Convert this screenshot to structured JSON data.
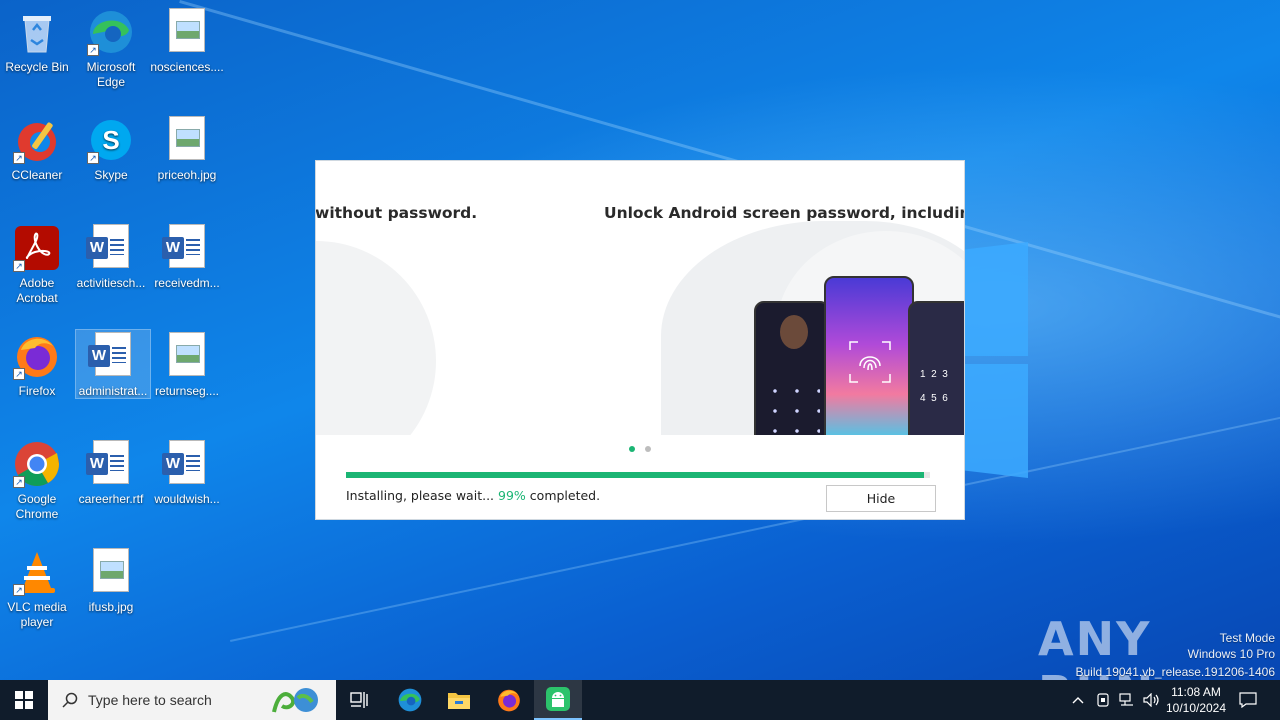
{
  "desktop": {
    "icons": [
      {
        "label": "Recycle Bin",
        "kind": "recycle-bin"
      },
      {
        "label": "Microsoft Edge",
        "kind": "edge"
      },
      {
        "label": "nosciences....",
        "kind": "image-file"
      },
      {
        "label": "CCleaner",
        "kind": "ccleaner"
      },
      {
        "label": "Skype",
        "kind": "skype"
      },
      {
        "label": "priceoh.jpg",
        "kind": "image-file"
      },
      {
        "label": "Adobe Acrobat",
        "kind": "acrobat"
      },
      {
        "label": "activitiesch...",
        "kind": "word-file"
      },
      {
        "label": "receivedm...",
        "kind": "word-file"
      },
      {
        "label": "Firefox",
        "kind": "firefox"
      },
      {
        "label": "administrat...",
        "kind": "word-file"
      },
      {
        "label": "returnseg....",
        "kind": "image-file"
      },
      {
        "label": "Google Chrome",
        "kind": "chrome"
      },
      {
        "label": "careerher.rtf",
        "kind": "word-file"
      },
      {
        "label": "wouldwish...",
        "kind": "word-file"
      },
      {
        "label": "VLC media player",
        "kind": "vlc"
      },
      {
        "label": "ifusb.jpg",
        "kind": "image-file"
      }
    ]
  },
  "installer": {
    "slide_text_left": "without password.",
    "slide_text_right": "Unlock Android screen password, including PIN,",
    "status_prefix": "Installing, please wait...",
    "status_percent": "99%",
    "status_suffix": "completed.",
    "progress": 0.99,
    "hide_label": "Hide",
    "accent": "#1bb574"
  },
  "watermark": {
    "brand": "ANY RUN",
    "line1": "Test Mode",
    "line2": "Windows 10 Pro",
    "line3": "Build 19041.vb_release.191206-1406"
  },
  "taskbar": {
    "search_placeholder": "Type here to search",
    "time": "11:08 AM",
    "date": "10/10/2024",
    "pinned": [
      "task-view",
      "edge",
      "file-explorer",
      "firefox",
      "installer-app"
    ]
  }
}
